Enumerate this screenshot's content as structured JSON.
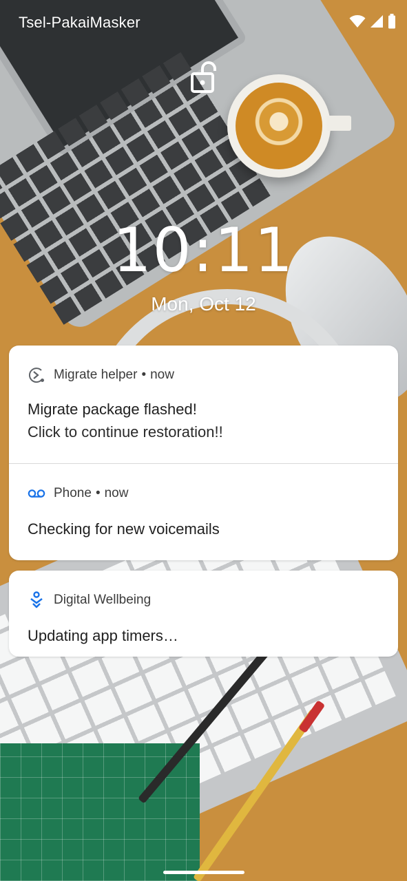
{
  "status_bar": {
    "carrier": "Tsel-PakaiMasker",
    "icons": [
      "wifi-icon",
      "cell-signal-icon",
      "battery-icon"
    ]
  },
  "lockscreen": {
    "lock_icon": "unlock-icon",
    "time": "10:11",
    "date": "Mon, Oct 12"
  },
  "notifications": [
    {
      "app": "Migrate helper",
      "time": "now",
      "icon": "migrate-icon",
      "title": "Migrate package flashed!",
      "text": "Click to continue restoration!!"
    },
    {
      "app": "Phone",
      "time": "now",
      "icon": "voicemail-icon",
      "icon_color": "#1a73e8",
      "title": "Checking for new voicemails"
    },
    {
      "app": "Digital Wellbeing",
      "icon": "digital-wellbeing-icon",
      "icon_color": "#1a73e8",
      "title": "Updating app timers…"
    }
  ],
  "colors": {
    "wallpaper_base": "#c98f3e",
    "card_background": "#ffffff",
    "accent": "#1a73e8"
  }
}
